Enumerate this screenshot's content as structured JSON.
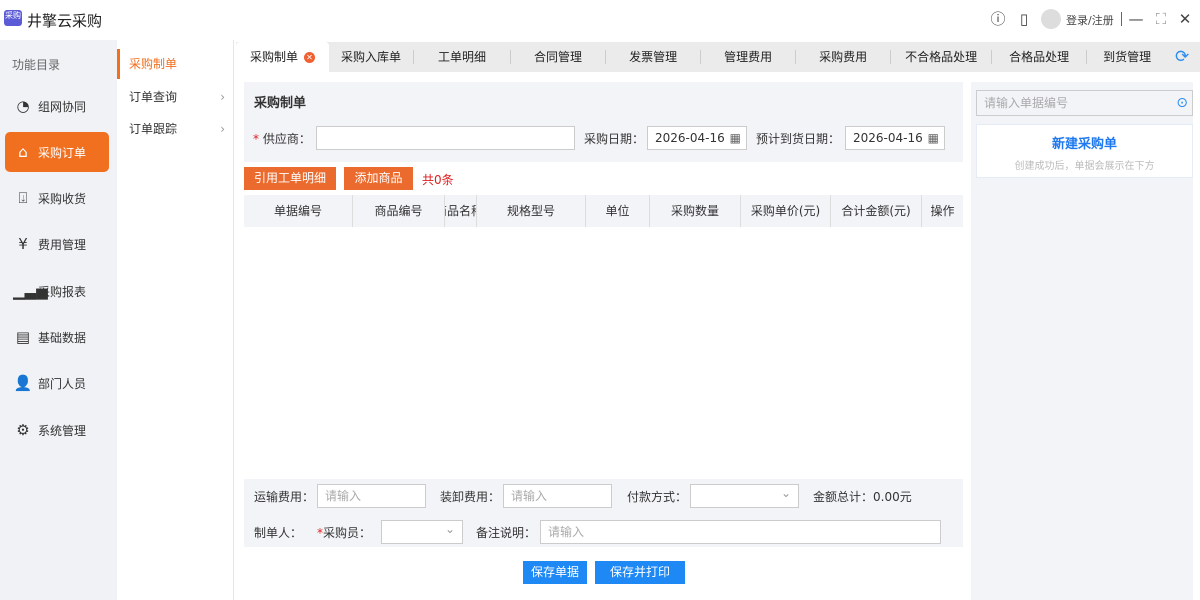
{
  "app": {
    "logo_text": "采购",
    "title": "井擎云采购",
    "login": "登录/注册"
  },
  "sidebar": {
    "title": "功能目录",
    "items": [
      {
        "label": "组网协同",
        "icon": "network-icon"
      },
      {
        "label": "采购订单",
        "icon": "basket-icon",
        "active": true
      },
      {
        "label": "采购收货",
        "icon": "receive-icon"
      },
      {
        "label": "费用管理",
        "icon": "yen-icon"
      },
      {
        "label": "采购报表",
        "icon": "chart-icon"
      },
      {
        "label": "基础数据",
        "icon": "database-icon"
      },
      {
        "label": "部门人员",
        "icon": "users-icon"
      },
      {
        "label": "系统管理",
        "icon": "gear-icon"
      }
    ]
  },
  "submenu": {
    "items": [
      {
        "label": "采购制单",
        "active": true
      },
      {
        "label": "订单查询"
      },
      {
        "label": "订单跟踪"
      }
    ]
  },
  "tabs": [
    {
      "label": "采购制单",
      "active": true
    },
    {
      "label": "采购入库单"
    },
    {
      "label": "工单明细"
    },
    {
      "label": "合同管理"
    },
    {
      "label": "发票管理"
    },
    {
      "label": "管理费用"
    },
    {
      "label": "采购费用"
    },
    {
      "label": "不合格品处理"
    },
    {
      "label": "合格品处理"
    },
    {
      "label": "到货管理"
    }
  ],
  "form": {
    "title": "采购制单",
    "supplier_label": "供应商：",
    "supplier_value": "",
    "purchase_date_label": "采购日期：",
    "purchase_date": "2026-04-16",
    "arrival_date_label": "预计到货日期：",
    "arrival_date": "2026-04-16"
  },
  "actions": {
    "cite": "引用工单明细",
    "add": "添加商品",
    "count": "共0条"
  },
  "table": {
    "columns": [
      "单据编号",
      "商品编号",
      "商品名称",
      "规格型号",
      "单位",
      "采购数量",
      "采购单价(元)",
      "合计金额(元)",
      "操作"
    ],
    "rows": []
  },
  "footer": {
    "shipping_label": "运输费用：",
    "shipping_ph": "请输入",
    "loading_label": "装卸费用：",
    "loading_ph": "请输入",
    "payment_label": "付款方式：",
    "payment_value": "",
    "total_label": "金额总计：0.00元",
    "maker_label": "制单人：",
    "buyer_label": "采购员：",
    "buyer_value": "",
    "remark_label": "备注说明：",
    "remark_ph": "请输入",
    "save": "保存单据",
    "save_print": "保存并打印"
  },
  "right": {
    "search_ph": "请输入单据编号",
    "card_title": "新建采购单",
    "card_sub": "创建成功后，单据会展示在下方"
  },
  "colors": {
    "accent": "#f07020",
    "primary": "#1e88f5"
  }
}
